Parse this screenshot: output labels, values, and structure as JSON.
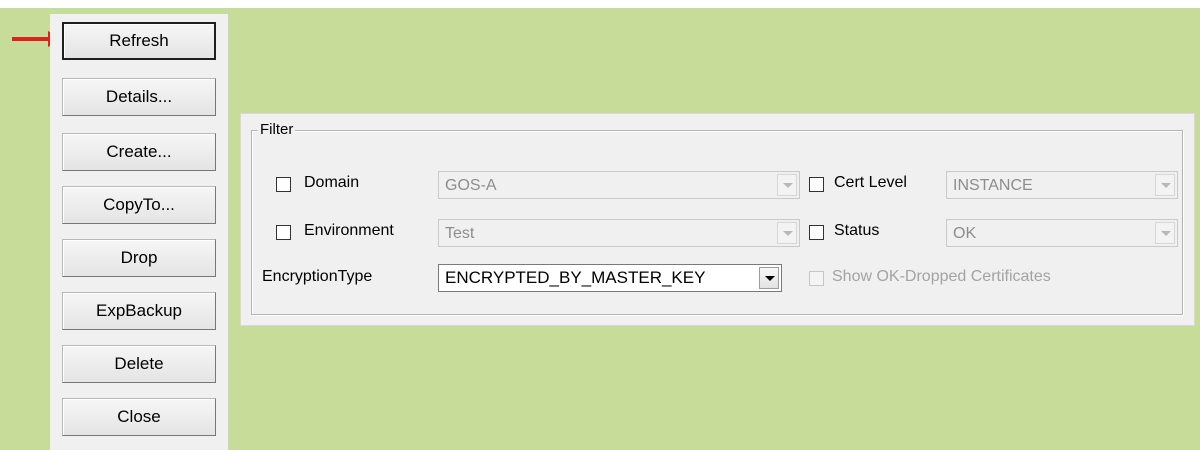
{
  "buttons": {
    "refresh": "Refresh",
    "details": "Details...",
    "create": "Create...",
    "copyto": "CopyTo...",
    "drop": "Drop",
    "expbackup": "ExpBackup",
    "delete": "Delete",
    "close": "Close"
  },
  "filter": {
    "title": "Filter",
    "domain": {
      "label": "Domain",
      "checked": false,
      "value": "GOS-A"
    },
    "environment": {
      "label": "Environment",
      "checked": false,
      "value": "Test"
    },
    "encryption_type": {
      "label": "EncryptionType",
      "value": "ENCRYPTED_BY_MASTER_KEY"
    },
    "cert_level": {
      "label": "Cert Level",
      "checked": false,
      "value": "INSTANCE"
    },
    "status": {
      "label": "Status",
      "checked": false,
      "value": "OK"
    },
    "show_ok_dropped": {
      "label": "Show OK-Dropped Certificates",
      "checked": false,
      "enabled": false
    }
  },
  "colors": {
    "background": "#c8dc9a",
    "panel": "#f0f0f0",
    "arrow": "#e0201c"
  },
  "icons": {
    "pointer": "red-arrow-icon"
  }
}
